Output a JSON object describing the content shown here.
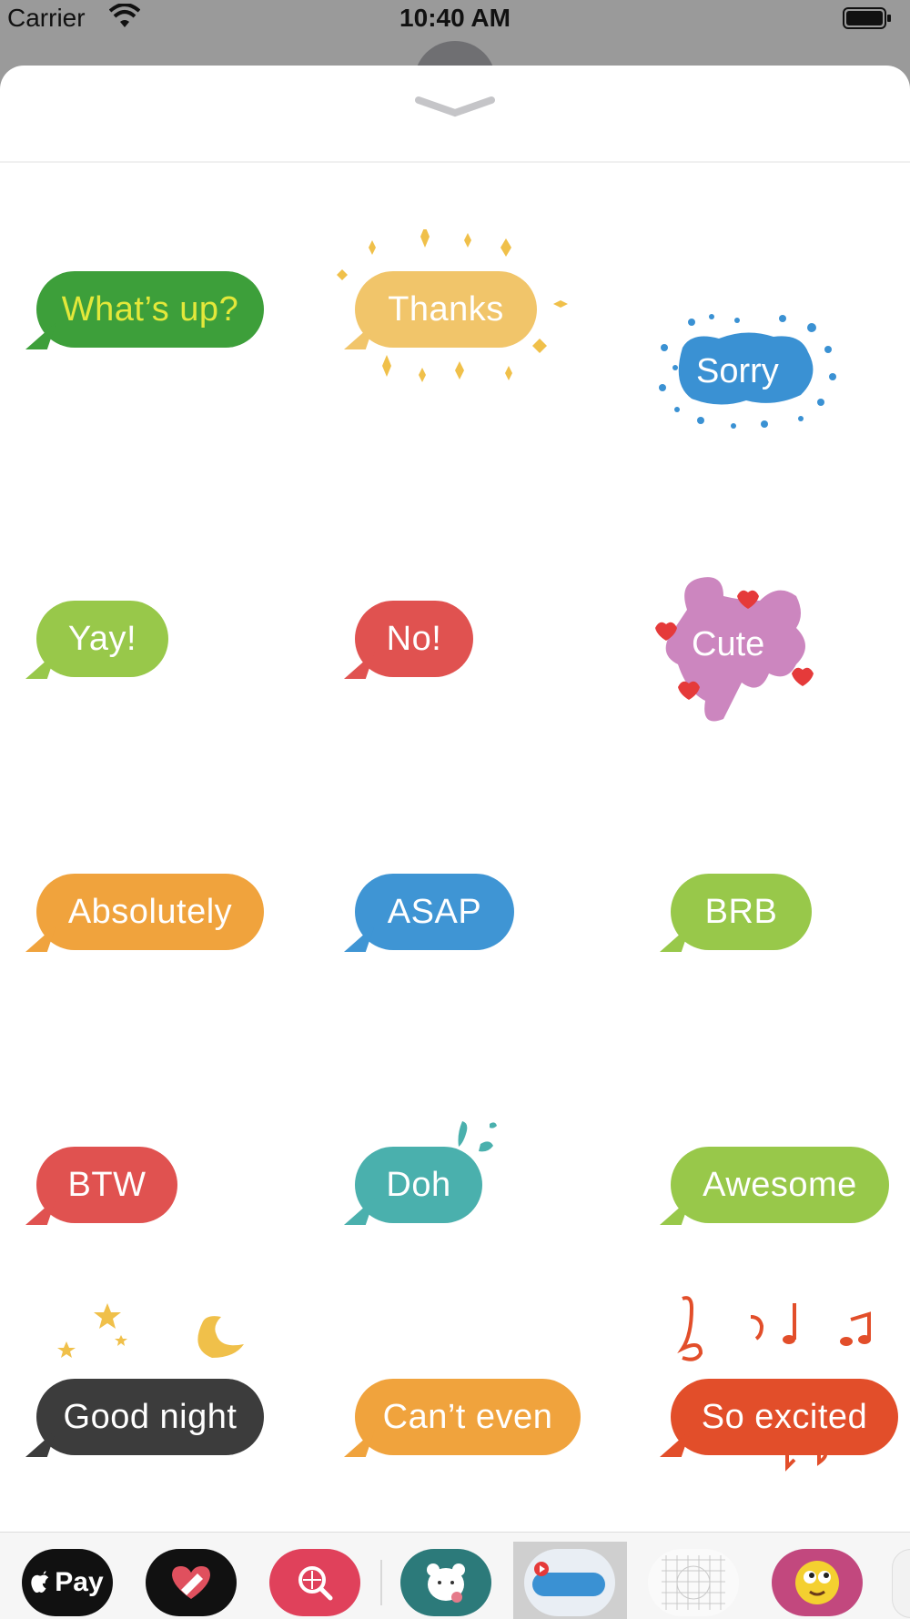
{
  "status_bar": {
    "carrier": "Carrier",
    "time": "10:40 AM"
  },
  "stickers": [
    {
      "label": "What’s up?",
      "color": "#3d9f3a",
      "text_color": "#e3e83a"
    },
    {
      "label": "Thanks",
      "color": "#f1c56a"
    },
    {
      "label": "Sorry",
      "color": "#3a91d3"
    },
    {
      "label": "Yay!",
      "color": "#98c84a"
    },
    {
      "label": "No!",
      "color": "#e05250"
    },
    {
      "label": "Cute",
      "color": "#cc86bf"
    },
    {
      "label": "Absolutely",
      "color": "#f0a33d"
    },
    {
      "label": "ASAP",
      "color": "#3f95d4"
    },
    {
      "label": "BRB",
      "color": "#98c84a"
    },
    {
      "label": "BTW",
      "color": "#e05250"
    },
    {
      "label": "Doh",
      "color": "#4ab0ad"
    },
    {
      "label": "Awesome",
      "color": "#98c84a"
    },
    {
      "label": "Good night",
      "color": "#3c3c3c"
    },
    {
      "label": "Can’t even",
      "color": "#f0a33d"
    },
    {
      "label": "So excited",
      "color": "#e24e2a"
    }
  ],
  "app_tray": {
    "apple_pay_label": "Pay",
    "items": [
      {
        "icon": "apple-pay-icon"
      },
      {
        "icon": "heart-sticker-icon"
      },
      {
        "icon": "image-search-icon"
      },
      {
        "icon": "bear-sticker-icon"
      },
      {
        "icon": "colorful-text-icon",
        "selected": true
      },
      {
        "icon": "grid-sticker-icon"
      },
      {
        "icon": "emoji-face-icon"
      }
    ]
  }
}
